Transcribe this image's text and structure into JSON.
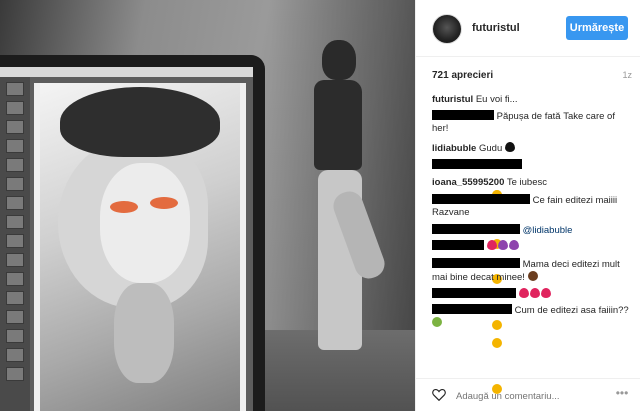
{
  "post": {
    "username": "futuristul",
    "follow_label": "Urmărește",
    "likes": "721 aprecieri",
    "time": "1z"
  },
  "comments": [
    {
      "user": "futuristul",
      "text": "Eu voi fi..."
    },
    {
      "user": "",
      "text": "Păpușa de fată",
      "text2": "Take care of her!"
    },
    {
      "user": "lidiabuble",
      "text": "Gudu"
    },
    {
      "user": "",
      "text": ""
    },
    {
      "user": "ioana_55995200",
      "text": "Te iubesc"
    },
    {
      "user": "",
      "text": "Ce fain editezi maiiii Razvane"
    },
    {
      "user": "",
      "text": "@lidiabuble",
      "mention": "@lidiabuble"
    },
    {
      "user": "",
      "text": ""
    },
    {
      "user": "",
      "text": "Mama deci editezi mult mai bine decat minee!"
    },
    {
      "user": "",
      "text": ""
    },
    {
      "user": "",
      "text": "Cum de editezi asa faiiin??"
    }
  ],
  "footer": {
    "placeholder": "Adaugă un comentariu...",
    "more_label": "•••"
  },
  "icons": {
    "like": "heart-outline-icon",
    "more": "more-options-icon"
  },
  "colors": {
    "follow_button": "#3897f0",
    "mention": "#003569"
  }
}
